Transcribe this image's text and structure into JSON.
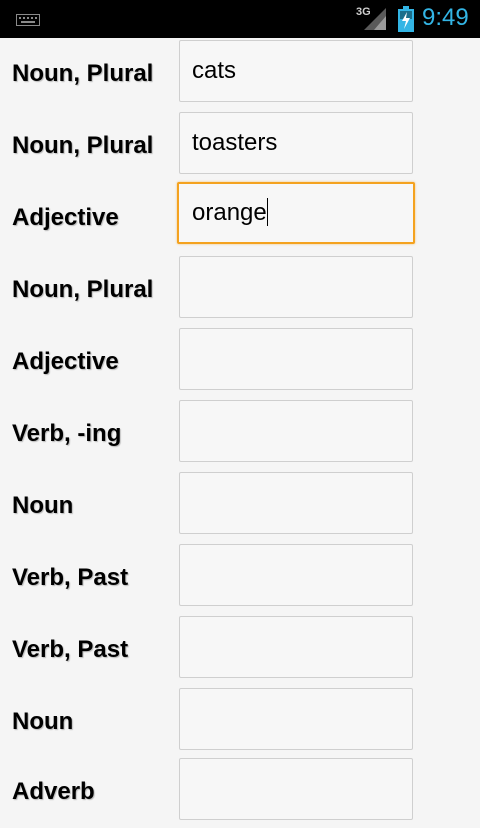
{
  "status_bar": {
    "network": "3G",
    "time": "9:49",
    "icons": [
      "keyboard-icon",
      "signal-icon",
      "battery-charging-icon"
    ],
    "accent_color": "#33b5e5"
  },
  "form": {
    "focus_color": "#f4a21f",
    "rows": [
      {
        "label": "Noun, Plural",
        "value": "cats"
      },
      {
        "label": "Noun, Plural",
        "value": "toasters"
      },
      {
        "label": "Adjective",
        "value": "orange",
        "focused": true
      },
      {
        "label": "Noun, Plural",
        "value": ""
      },
      {
        "label": "Adjective",
        "value": ""
      },
      {
        "label": "Verb, -ing",
        "value": ""
      },
      {
        "label": "Noun",
        "value": ""
      },
      {
        "label": "Verb, Past",
        "value": ""
      },
      {
        "label": "Verb, Past",
        "value": ""
      },
      {
        "label": "Noun",
        "value": ""
      },
      {
        "label": "Adverb",
        "value": ""
      }
    ]
  }
}
